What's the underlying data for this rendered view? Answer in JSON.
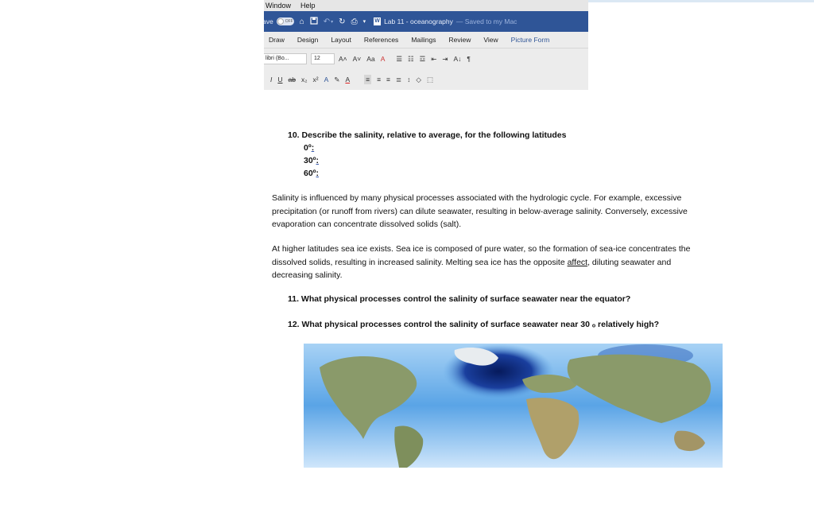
{
  "menubar": {
    "items": [
      "Window",
      "Help"
    ]
  },
  "titlebar": {
    "autosave_label": "ave",
    "toggle_label": "OFF",
    "doc_title": "Lab 11 - oceanography",
    "saved_status": "— Saved to my Mac"
  },
  "ribbon_tabs": [
    "Draw",
    "Design",
    "Layout",
    "References",
    "Mailings",
    "Review",
    "View",
    "Picture Form"
  ],
  "font": {
    "name": "libri (Bo...",
    "size": "12"
  },
  "row1_buttons": {
    "grow": "A˄",
    "shrink": "A˅",
    "case": "Aa",
    "clear": "A",
    "sort": "A↓",
    "pilcrow": "¶"
  },
  "row2_buttons": {
    "italic": "I",
    "underline": "U",
    "strike": "ab",
    "sub": "x₂",
    "sup": "x²",
    "highlight": "A",
    "color": "A"
  },
  "document": {
    "q10_title": "10. Describe the salinity, relative to average, for the following latitudes",
    "lat_0": "0º",
    "lat_30": "30º",
    "lat_60": "60º",
    "lat_suffix": ":",
    "para1": "Salinity is influenced by many physical processes associated with the hydrologic cycle. For example, excessive precipitation (or runoff from rivers) can dilute seawater, resulting in below-average salinity. Conversely, excessive evaporation can concentrate dissolved solids (salt).",
    "para2_a": "At higher latitudes sea ice exists.  Sea ice is composed of pure water, so the formation of sea-ice concentrates the dissolved solids, resulting in increased salinity.  Melting sea ice has the opposite ",
    "para2_affect": "affect",
    "para2_b": ", diluting seawater and decreasing salinity.",
    "q11": "11. What physical processes control the salinity of surface seawater near the equator?",
    "q12": "12. What physical processes control the salinity of surface seawater near 30 ₒ relatively high?"
  },
  "colors": {
    "titlebar": "#2f5597",
    "ocean_light": "#d7ecfb",
    "ocean_mid": "#4f9be0",
    "ocean_dark": "#0a1f66",
    "land": "#8a9a6a"
  }
}
